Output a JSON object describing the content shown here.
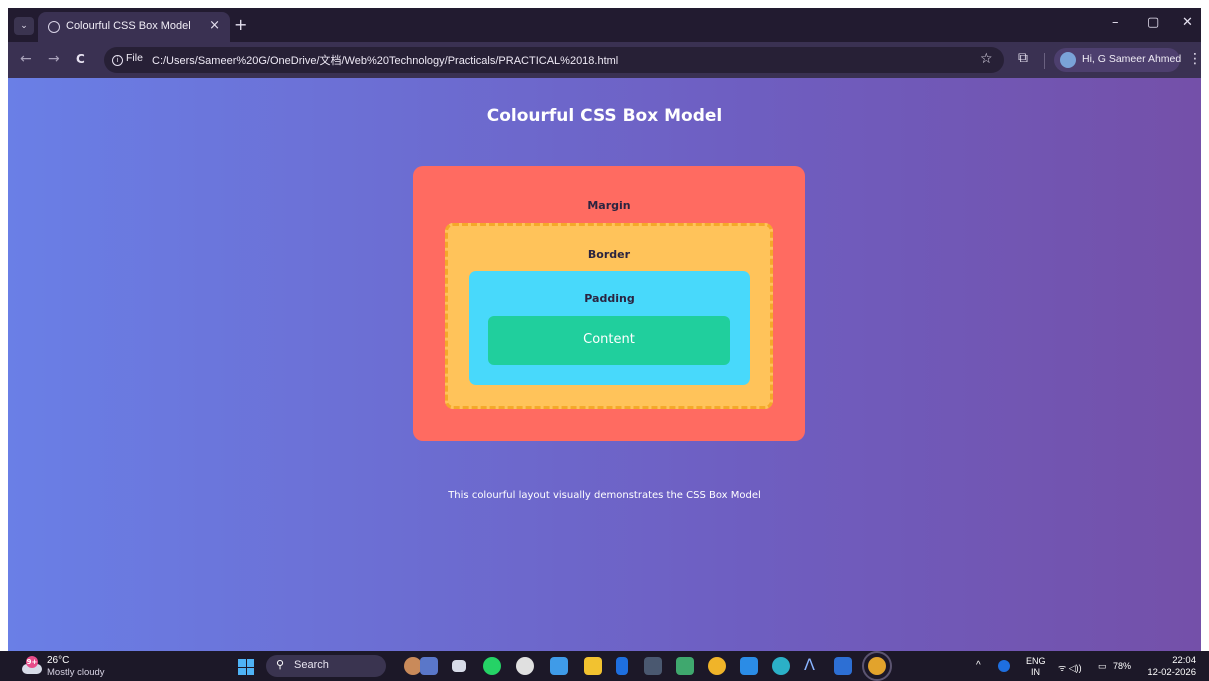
{
  "browser": {
    "tab_title": "Colourful CSS Box Model",
    "tab_close": "×",
    "new_tab": "+",
    "window_minimize": "–",
    "window_restore": "▢",
    "window_close": "✕",
    "back": "←",
    "forward": "→",
    "reload": "C",
    "file_chip": "File",
    "url": "C:/Users/Sameer%20G/OneDrive/文档/Web%20Technology/Practicals/PRACTICAL%2018.html",
    "bookmark_icon": "☆",
    "extensions_icon": "⧉",
    "profile_name": "Hi, G Sameer Ahmed",
    "menu_icon": "⋮"
  },
  "page": {
    "heading": "Colourful CSS Box Model",
    "margin_label": "Margin",
    "border_label": "Border",
    "padding_label": "Padding",
    "content_label": "Content",
    "caption": "This colourful layout visually demonstrates the CSS Box Model",
    "colors": {
      "margin": "#ff6b61",
      "border": "#ffc35a",
      "padding": "#48d9fb",
      "content": "#20cf9d"
    }
  },
  "taskbar": {
    "weather_badge": "9+",
    "temperature": "26°C",
    "weather_desc": "Mostly cloudy",
    "search_label": "Search",
    "tray_chevron": "^",
    "language_top": "ENG",
    "language_bottom": "IN",
    "wifi_volume": "ᯤ ◁))",
    "battery": "78%",
    "time": "22:04",
    "date": "12-02-2026"
  }
}
